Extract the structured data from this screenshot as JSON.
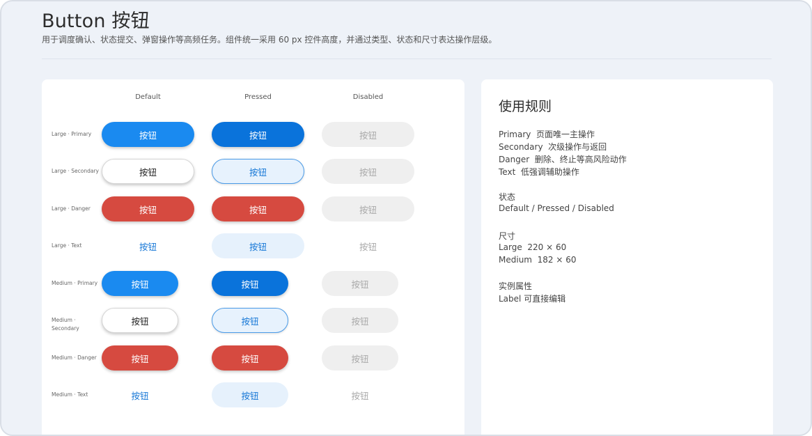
{
  "page": {
    "title": "Button 按钮",
    "description": "用于调度确认、状态提交、弹窗操作等高频任务。组件统一采用 60 px 控件高度，并通过类型、状态和尺寸表达操作层级。"
  },
  "matrix": {
    "columns": [
      "Default",
      "Pressed",
      "Disabled"
    ],
    "button_label": "按钮",
    "rows": [
      {
        "label": "Large · Primary"
      },
      {
        "label": "Large · Secondary"
      },
      {
        "label": "Large · Danger"
      },
      {
        "label": "Large · Text"
      },
      {
        "label": "Medium · Primary"
      },
      {
        "label_line1": "Medium ·",
        "label_line2": "Secondary"
      },
      {
        "label": "Medium · Danger"
      },
      {
        "label": "Medium · Text"
      }
    ]
  },
  "rules": {
    "title": "使用规则",
    "lines": [
      "Primary  页面唯一主操作",
      "Secondary  次级操作与返回",
      "Danger  删除、终止等高风险动作",
      "Text  低强调辅助操作",
      "状态",
      "Default / Pressed / Disabled",
      "尺寸",
      "Large  220 × 60",
      "Medium  182 × 60",
      "实例属性",
      "Label 可直接编辑"
    ]
  },
  "colors": {
    "primary": "#1a8af0",
    "primary_pressed": "#0a73db",
    "danger": "#d64a40",
    "text_link": "#1677d6",
    "disabled_bg": "#efefef",
    "disabled_text": "#a9a9a9",
    "background": "#eef2f8"
  }
}
